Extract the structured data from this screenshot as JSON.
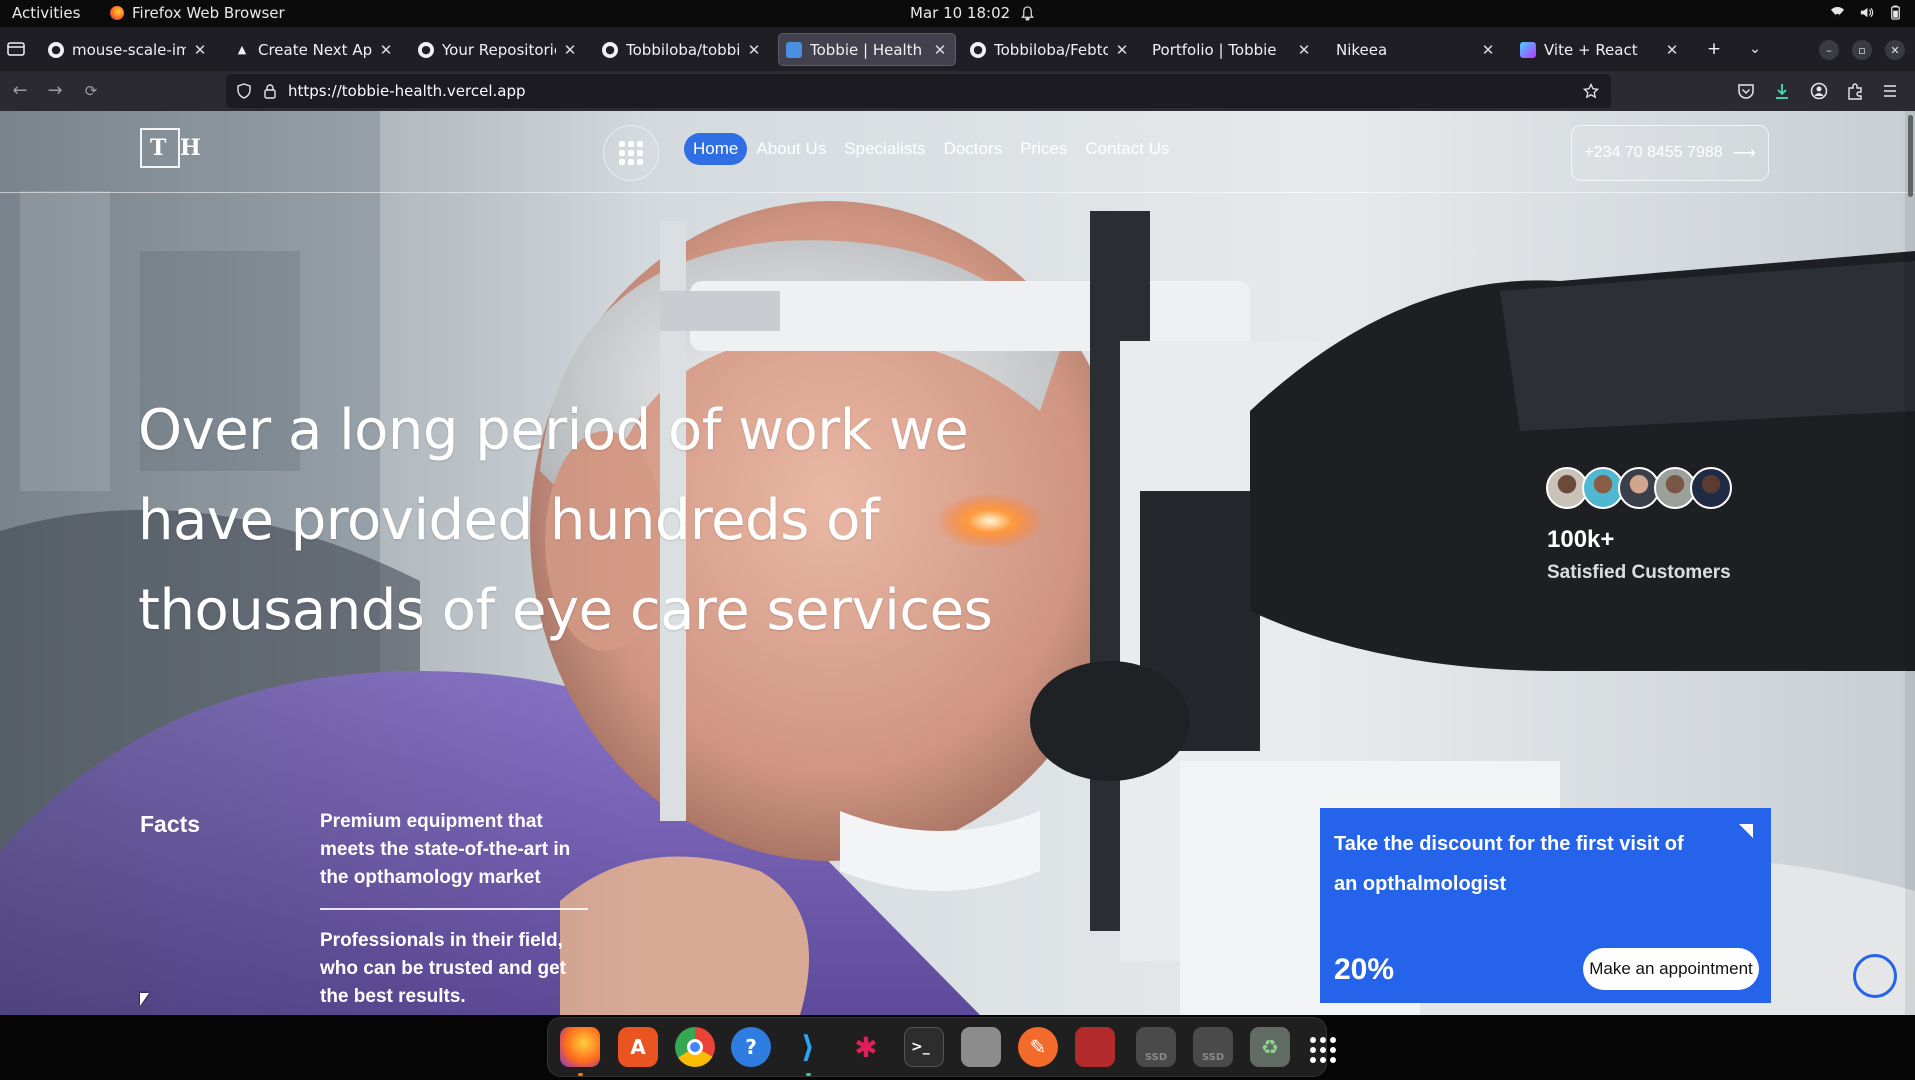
{
  "topbar": {
    "activities": "Activities",
    "app_name": "Firefox Web Browser",
    "datetime": "Mar 10  18:02"
  },
  "tabs": [
    {
      "label": "mouse-scale-image",
      "icon": "github-icon",
      "active": false
    },
    {
      "label": "Create Next App",
      "icon": "triangle-icon",
      "active": false
    },
    {
      "label": "Your Repositories",
      "icon": "github-icon",
      "active": false
    },
    {
      "label": "Tobbiloba/tobbie-h",
      "icon": "github-icon",
      "active": false
    },
    {
      "label": "Tobbie | Health",
      "icon": "site-icon",
      "active": true
    },
    {
      "label": "Tobbiloba/Febtos-l",
      "icon": "github-icon",
      "active": false
    },
    {
      "label": "Portfolio | Tobbie",
      "icon": "none",
      "active": false
    },
    {
      "label": "Nikeea",
      "icon": "none",
      "active": false
    },
    {
      "label": "Vite + React",
      "icon": "vite-icon",
      "active": false
    }
  ],
  "navbar": {
    "url": "https://tobbie-health.vercel.app"
  },
  "site": {
    "logo_t": "T",
    "logo_h": "H",
    "nav": [
      "Home",
      "About Us",
      "Specialists",
      "Doctors",
      "Prices",
      "Contact Us"
    ],
    "nav_current": "Home",
    "phone": "+234 70 8455 7988",
    "phone_arrow": "⟶",
    "hero_title": "Over a long period of work we have provided hundreds of thousands of eye care services",
    "customers_count": "100k+",
    "customers_label": "Satisfied Customers",
    "facts_title": "Facts",
    "fact_1": "Premium equipment that meets the state-of-the-art in the opthamology market",
    "fact_2": "Professionals in their field, who can be trusted and get the best results.",
    "promo_text": "Take the discount for the first visit of an opthalmologist",
    "promo_percent": "20%",
    "promo_button": "Make an appointment"
  },
  "colors": {
    "accent": "#2563eb",
    "nav_active": "#2f6ee5",
    "tabbar": "#1f1e25",
    "toolbar": "#2b2a33"
  },
  "dock": [
    "firefox",
    "app-center",
    "chrome",
    "help",
    "vscode",
    "slack",
    "terminal",
    "files",
    "pen-tool",
    "screen-recorder",
    "ssd-drive-1",
    "ssd-drive-2",
    "trash",
    "show-apps"
  ]
}
